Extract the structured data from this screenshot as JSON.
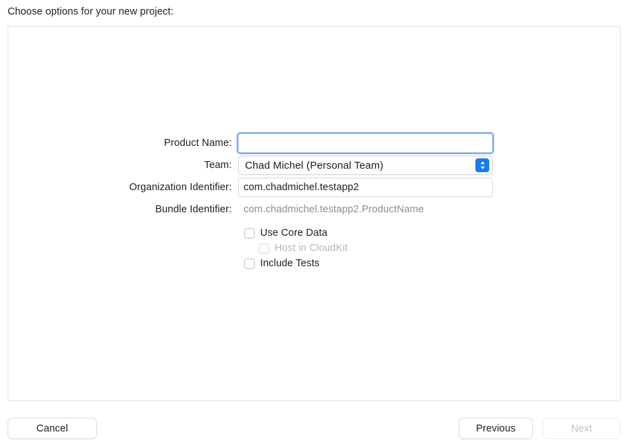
{
  "header": {
    "prompt": "Choose options for your new project:"
  },
  "form": {
    "fields": [
      {
        "label": "Product Name:",
        "type": "textfield",
        "value": "",
        "placeholder": "",
        "focused": true,
        "name": "product-name"
      },
      {
        "label": "Team:",
        "type": "popup",
        "value": "Chad Michel (Personal Team)",
        "name": "team"
      },
      {
        "label": "Organization Identifier:",
        "type": "textfield",
        "value": "com.chadmichel.testapp2",
        "placeholder": "",
        "focused": false,
        "name": "organization-identifier"
      },
      {
        "label": "Bundle Identifier:",
        "type": "readonly",
        "value": "com.chadmichel.testapp2.ProductName",
        "name": "bundle-identifier"
      }
    ],
    "checkboxes": [
      {
        "label": "Use Core Data",
        "checked": false,
        "disabled": false,
        "indented": false,
        "name": "use-core-data"
      },
      {
        "label": "Host in CloudKit",
        "checked": false,
        "disabled": true,
        "indented": true,
        "name": "host-in-cloudkit"
      },
      {
        "label": "Include Tests",
        "checked": false,
        "disabled": false,
        "indented": false,
        "name": "include-tests"
      }
    ]
  },
  "footer": {
    "cancel_label": "Cancel",
    "previous_label": "Previous",
    "next_label": "Next",
    "next_disabled": true
  },
  "colors": {
    "accent": "#147cf4",
    "focus_ring": "#86aeee",
    "panel_border": "#e3e3e3",
    "disabled_text": "#b6b6ba"
  },
  "icons": {
    "popup_arrows": "chevron-up-down-icon"
  }
}
